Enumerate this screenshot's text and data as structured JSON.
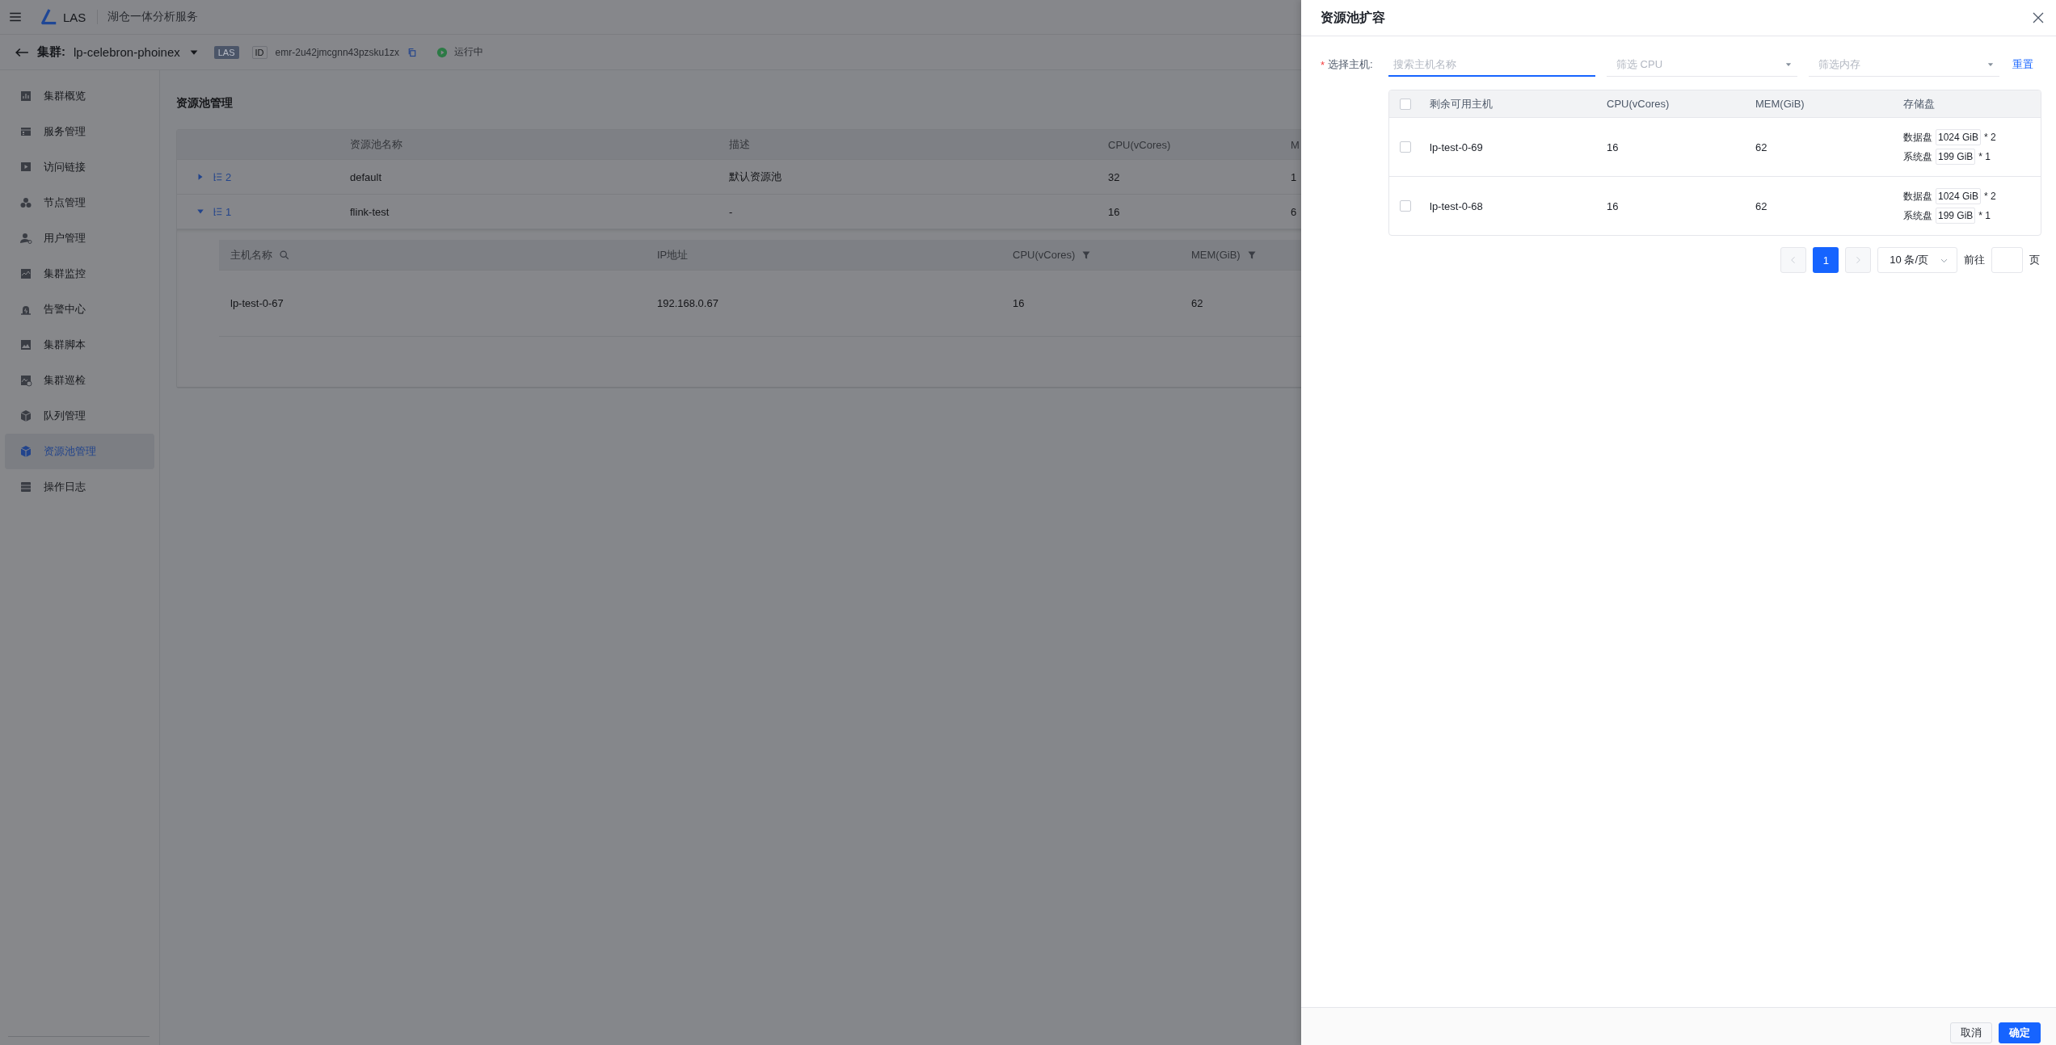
{
  "header": {
    "app_name": "LAS",
    "service": "湖仓一体分析服务"
  },
  "cluster_bar": {
    "label": "集群:",
    "name": "lp-celebron-phoinex",
    "tag": "LAS",
    "id_label": "ID",
    "id": "emr-2u42jmcgnn43pzsku1zx",
    "status": "运行中"
  },
  "sidebar": {
    "items": [
      {
        "label": "集群概览",
        "selected": false
      },
      {
        "label": "服务管理",
        "selected": false
      },
      {
        "label": "访问链接",
        "selected": false
      },
      {
        "label": "节点管理",
        "selected": false
      },
      {
        "label": "用户管理",
        "selected": false
      },
      {
        "label": "集群监控",
        "selected": false
      },
      {
        "label": "告警中心",
        "selected": false
      },
      {
        "label": "集群脚本",
        "selected": false
      },
      {
        "label": "集群巡检",
        "selected": false
      },
      {
        "label": "队列管理",
        "selected": false
      },
      {
        "label": "资源池管理",
        "selected": true
      },
      {
        "label": "操作日志",
        "selected": false
      }
    ]
  },
  "page": {
    "title": "资源池管理",
    "table": {
      "columns": [
        "资源池名称",
        "描述",
        "CPU(vCores)",
        "M"
      ],
      "rows": [
        {
          "count": "2",
          "expanded": false,
          "name": "default",
          "description": "默认资源池",
          "cpu": "32",
          "column_5": "1"
        },
        {
          "count": "1",
          "expanded": true,
          "name": "flink-test",
          "description": "-",
          "cpu": "16",
          "column_5": "6"
        }
      ]
    },
    "hosts_table": {
      "columns": [
        {
          "label": "主机名称",
          "kind": "search"
        },
        {
          "label": "IP地址",
          "kind": "plain"
        },
        {
          "label": "CPU(vCores)",
          "kind": "filter"
        },
        {
          "label": "MEM(GiB)",
          "kind": "filter"
        }
      ],
      "rows": [
        [
          "lp-test-0-67",
          "192.168.0.67",
          "16",
          "62"
        ]
      ]
    }
  },
  "drawer": {
    "title": "资源池扩容",
    "form_label": "选择主机:",
    "required_mark": "*",
    "search": {
      "placeholder": "搜索主机名称",
      "focused": true
    },
    "filters": [
      {
        "placeholder": "筛选 CPU"
      },
      {
        "placeholder": "筛选内存"
      }
    ],
    "reset": "重置",
    "table": {
      "select_all": {
        "checked": false
      },
      "columns": [
        "剩余可用主机",
        "CPU(vCores)",
        "MEM(GiB)",
        "存储盘"
      ],
      "rows": [
        {
          "checked": false,
          "host": "lp-test-0-69",
          "cpu": "16",
          "mem": "62",
          "disks": [
            {
              "label": "数据盘",
              "size": "1024 GiB",
              "count": "* 2"
            },
            {
              "label": "系统盘",
              "size": "199 GiB",
              "count": "* 1"
            }
          ]
        },
        {
          "checked": false,
          "host": "lp-test-0-68",
          "cpu": "16",
          "mem": "62",
          "disks": [
            {
              "label": "数据盘",
              "size": "1024 GiB",
              "count": "* 2"
            },
            {
              "label": "系统盘",
              "size": "199 GiB",
              "count": "* 1"
            }
          ]
        }
      ]
    },
    "pagination": {
      "pages": [
        {
          "label": "1",
          "selected": true
        }
      ],
      "page_size": "10 条/页",
      "goto_label": "前往",
      "goto_suffix": "页"
    },
    "buttons": [
      {
        "label": "取消",
        "kind": "default"
      },
      {
        "label": "确定",
        "kind": "primary"
      }
    ]
  }
}
